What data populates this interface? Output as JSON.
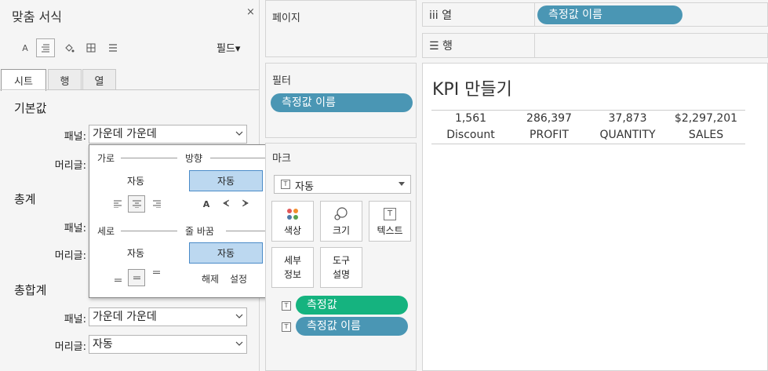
{
  "format_pane": {
    "title": "맞춤 서식",
    "close": "×",
    "fields_button": "필드▾",
    "toolbar": [
      {
        "name": "font-icon",
        "glyph": "A"
      },
      {
        "name": "alignment-icon",
        "glyph": "≡"
      },
      {
        "name": "shading-icon",
        "glyph": "◈"
      },
      {
        "name": "borders-icon",
        "glyph": "⊞"
      },
      {
        "name": "lines-icon",
        "glyph": "☰"
      }
    ],
    "tabs": [
      "시트",
      "행",
      "열"
    ],
    "sections": {
      "default": "기본값",
      "totals": "총계",
      "grand_totals": "총합계"
    },
    "labels": {
      "pane": "패널:",
      "header": "머리글:"
    },
    "default_pane_value": "가운데 가운데",
    "grand_pane_value": "가운데 가운데",
    "grand_header_value": "자동"
  },
  "popup": {
    "horizontal": "가로",
    "direction": "방향",
    "auto": "자동",
    "vertical": "세로",
    "wrap": "줄 바꿈",
    "wrap_off": "해제",
    "wrap_on": "설정",
    "dir_glyphs": [
      "A",
      "ᗉ",
      "ᗆ"
    ]
  },
  "pages": {
    "title": "페이지"
  },
  "filters": {
    "title": "필터",
    "pill": "측정값 이름"
  },
  "marks": {
    "title": "마크",
    "type": "자동",
    "buttons": {
      "color": "색상",
      "size": "크기",
      "text": "텍스트",
      "detail": "세부\n정보",
      "tooltip": "도구\n설명"
    },
    "detail_line1": "세부",
    "detail_line2": "정보",
    "tooltip_line1": "도구",
    "tooltip_line2": "설명",
    "pill_values": "측정값",
    "pill_names": "측정값 이름"
  },
  "columns_shelf": {
    "label": "iii  열",
    "pill": "측정값 이름"
  },
  "rows_shelf": {
    "label": "☰  행"
  },
  "view": {
    "title": "KPI 만들기",
    "values": [
      "1,561",
      "286,397",
      "37,873",
      "$2,297,201"
    ],
    "headers": [
      "Discount",
      "PROFIT",
      "QUANTITY",
      "SALES"
    ]
  },
  "colors": {
    "pill_blue": "#4a96b4",
    "pill_green": "#15b37f",
    "selected_option": "#bcd8f0"
  }
}
